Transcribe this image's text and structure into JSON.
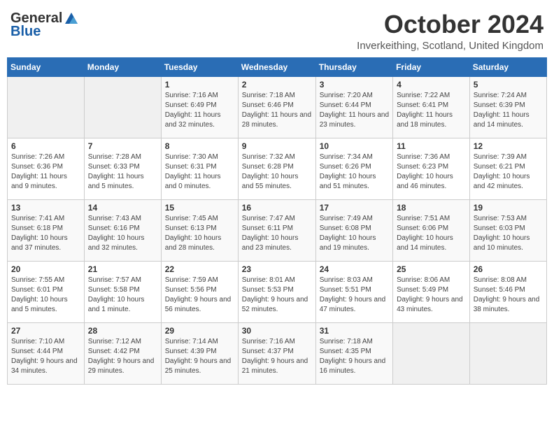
{
  "header": {
    "logo_general": "General",
    "logo_blue": "Blue",
    "month_title": "October 2024",
    "location": "Inverkeithing, Scotland, United Kingdom"
  },
  "weekdays": [
    "Sunday",
    "Monday",
    "Tuesday",
    "Wednesday",
    "Thursday",
    "Friday",
    "Saturday"
  ],
  "weeks": [
    [
      {
        "day": "",
        "empty": true
      },
      {
        "day": "",
        "empty": true
      },
      {
        "day": "1",
        "sunrise": "Sunrise: 7:16 AM",
        "sunset": "Sunset: 6:49 PM",
        "daylight": "Daylight: 11 hours and 32 minutes."
      },
      {
        "day": "2",
        "sunrise": "Sunrise: 7:18 AM",
        "sunset": "Sunset: 6:46 PM",
        "daylight": "Daylight: 11 hours and 28 minutes."
      },
      {
        "day": "3",
        "sunrise": "Sunrise: 7:20 AM",
        "sunset": "Sunset: 6:44 PM",
        "daylight": "Daylight: 11 hours and 23 minutes."
      },
      {
        "day": "4",
        "sunrise": "Sunrise: 7:22 AM",
        "sunset": "Sunset: 6:41 PM",
        "daylight": "Daylight: 11 hours and 18 minutes."
      },
      {
        "day": "5",
        "sunrise": "Sunrise: 7:24 AM",
        "sunset": "Sunset: 6:39 PM",
        "daylight": "Daylight: 11 hours and 14 minutes."
      }
    ],
    [
      {
        "day": "6",
        "sunrise": "Sunrise: 7:26 AM",
        "sunset": "Sunset: 6:36 PM",
        "daylight": "Daylight: 11 hours and 9 minutes."
      },
      {
        "day": "7",
        "sunrise": "Sunrise: 7:28 AM",
        "sunset": "Sunset: 6:33 PM",
        "daylight": "Daylight: 11 hours and 5 minutes."
      },
      {
        "day": "8",
        "sunrise": "Sunrise: 7:30 AM",
        "sunset": "Sunset: 6:31 PM",
        "daylight": "Daylight: 11 hours and 0 minutes."
      },
      {
        "day": "9",
        "sunrise": "Sunrise: 7:32 AM",
        "sunset": "Sunset: 6:28 PM",
        "daylight": "Daylight: 10 hours and 55 minutes."
      },
      {
        "day": "10",
        "sunrise": "Sunrise: 7:34 AM",
        "sunset": "Sunset: 6:26 PM",
        "daylight": "Daylight: 10 hours and 51 minutes."
      },
      {
        "day": "11",
        "sunrise": "Sunrise: 7:36 AM",
        "sunset": "Sunset: 6:23 PM",
        "daylight": "Daylight: 10 hours and 46 minutes."
      },
      {
        "day": "12",
        "sunrise": "Sunrise: 7:39 AM",
        "sunset": "Sunset: 6:21 PM",
        "daylight": "Daylight: 10 hours and 42 minutes."
      }
    ],
    [
      {
        "day": "13",
        "sunrise": "Sunrise: 7:41 AM",
        "sunset": "Sunset: 6:18 PM",
        "daylight": "Daylight: 10 hours and 37 minutes."
      },
      {
        "day": "14",
        "sunrise": "Sunrise: 7:43 AM",
        "sunset": "Sunset: 6:16 PM",
        "daylight": "Daylight: 10 hours and 32 minutes."
      },
      {
        "day": "15",
        "sunrise": "Sunrise: 7:45 AM",
        "sunset": "Sunset: 6:13 PM",
        "daylight": "Daylight: 10 hours and 28 minutes."
      },
      {
        "day": "16",
        "sunrise": "Sunrise: 7:47 AM",
        "sunset": "Sunset: 6:11 PM",
        "daylight": "Daylight: 10 hours and 23 minutes."
      },
      {
        "day": "17",
        "sunrise": "Sunrise: 7:49 AM",
        "sunset": "Sunset: 6:08 PM",
        "daylight": "Daylight: 10 hours and 19 minutes."
      },
      {
        "day": "18",
        "sunrise": "Sunrise: 7:51 AM",
        "sunset": "Sunset: 6:06 PM",
        "daylight": "Daylight: 10 hours and 14 minutes."
      },
      {
        "day": "19",
        "sunrise": "Sunrise: 7:53 AM",
        "sunset": "Sunset: 6:03 PM",
        "daylight": "Daylight: 10 hours and 10 minutes."
      }
    ],
    [
      {
        "day": "20",
        "sunrise": "Sunrise: 7:55 AM",
        "sunset": "Sunset: 6:01 PM",
        "daylight": "Daylight: 10 hours and 5 minutes."
      },
      {
        "day": "21",
        "sunrise": "Sunrise: 7:57 AM",
        "sunset": "Sunset: 5:58 PM",
        "daylight": "Daylight: 10 hours and 1 minute."
      },
      {
        "day": "22",
        "sunrise": "Sunrise: 7:59 AM",
        "sunset": "Sunset: 5:56 PM",
        "daylight": "Daylight: 9 hours and 56 minutes."
      },
      {
        "day": "23",
        "sunrise": "Sunrise: 8:01 AM",
        "sunset": "Sunset: 5:53 PM",
        "daylight": "Daylight: 9 hours and 52 minutes."
      },
      {
        "day": "24",
        "sunrise": "Sunrise: 8:03 AM",
        "sunset": "Sunset: 5:51 PM",
        "daylight": "Daylight: 9 hours and 47 minutes."
      },
      {
        "day": "25",
        "sunrise": "Sunrise: 8:06 AM",
        "sunset": "Sunset: 5:49 PM",
        "daylight": "Daylight: 9 hours and 43 minutes."
      },
      {
        "day": "26",
        "sunrise": "Sunrise: 8:08 AM",
        "sunset": "Sunset: 5:46 PM",
        "daylight": "Daylight: 9 hours and 38 minutes."
      }
    ],
    [
      {
        "day": "27",
        "sunrise": "Sunrise: 7:10 AM",
        "sunset": "Sunset: 4:44 PM",
        "daylight": "Daylight: 9 hours and 34 minutes."
      },
      {
        "day": "28",
        "sunrise": "Sunrise: 7:12 AM",
        "sunset": "Sunset: 4:42 PM",
        "daylight": "Daylight: 9 hours and 29 minutes."
      },
      {
        "day": "29",
        "sunrise": "Sunrise: 7:14 AM",
        "sunset": "Sunset: 4:39 PM",
        "daylight": "Daylight: 9 hours and 25 minutes."
      },
      {
        "day": "30",
        "sunrise": "Sunrise: 7:16 AM",
        "sunset": "Sunset: 4:37 PM",
        "daylight": "Daylight: 9 hours and 21 minutes."
      },
      {
        "day": "31",
        "sunrise": "Sunrise: 7:18 AM",
        "sunset": "Sunset: 4:35 PM",
        "daylight": "Daylight: 9 hours and 16 minutes."
      },
      {
        "day": "",
        "empty": true
      },
      {
        "day": "",
        "empty": true
      }
    ]
  ]
}
